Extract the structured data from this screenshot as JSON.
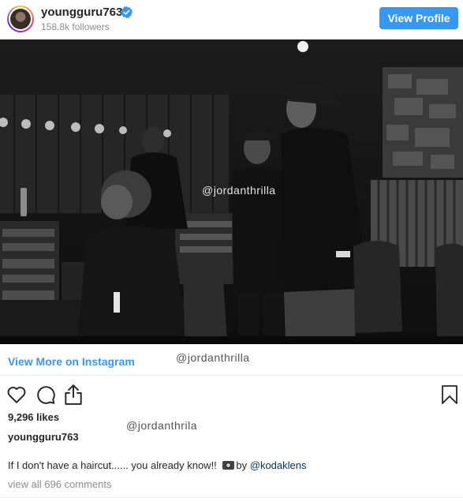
{
  "header": {
    "username": "youngguru763",
    "followers": "158.8k followers",
    "view_profile_label": "View Profile"
  },
  "photo": {
    "watermark": "@jordanthrilla"
  },
  "post": {
    "view_more_label": "View More on Instagram",
    "watermark_1": "@jordanthrilla",
    "likes": "9,296 likes",
    "watermark_2": "@jordanthrila",
    "owner": "youngguru763",
    "caption_text": "If I don't have a haircut...... you already know!! ",
    "caption_by": "by ",
    "caption_mention": "@kodaklens",
    "comments_link": "view all 696 comments"
  },
  "icons": {
    "heart": "heart-icon",
    "comment": "comment-icon",
    "share": "share-icon",
    "bookmark": "bookmark-icon",
    "verified": "verified-badge-icon",
    "camera": "camera-emoji-icon"
  },
  "colors": {
    "accent": "#3897f0",
    "text": "#262626",
    "muted": "#8e8e8e",
    "mention": "#003569"
  }
}
